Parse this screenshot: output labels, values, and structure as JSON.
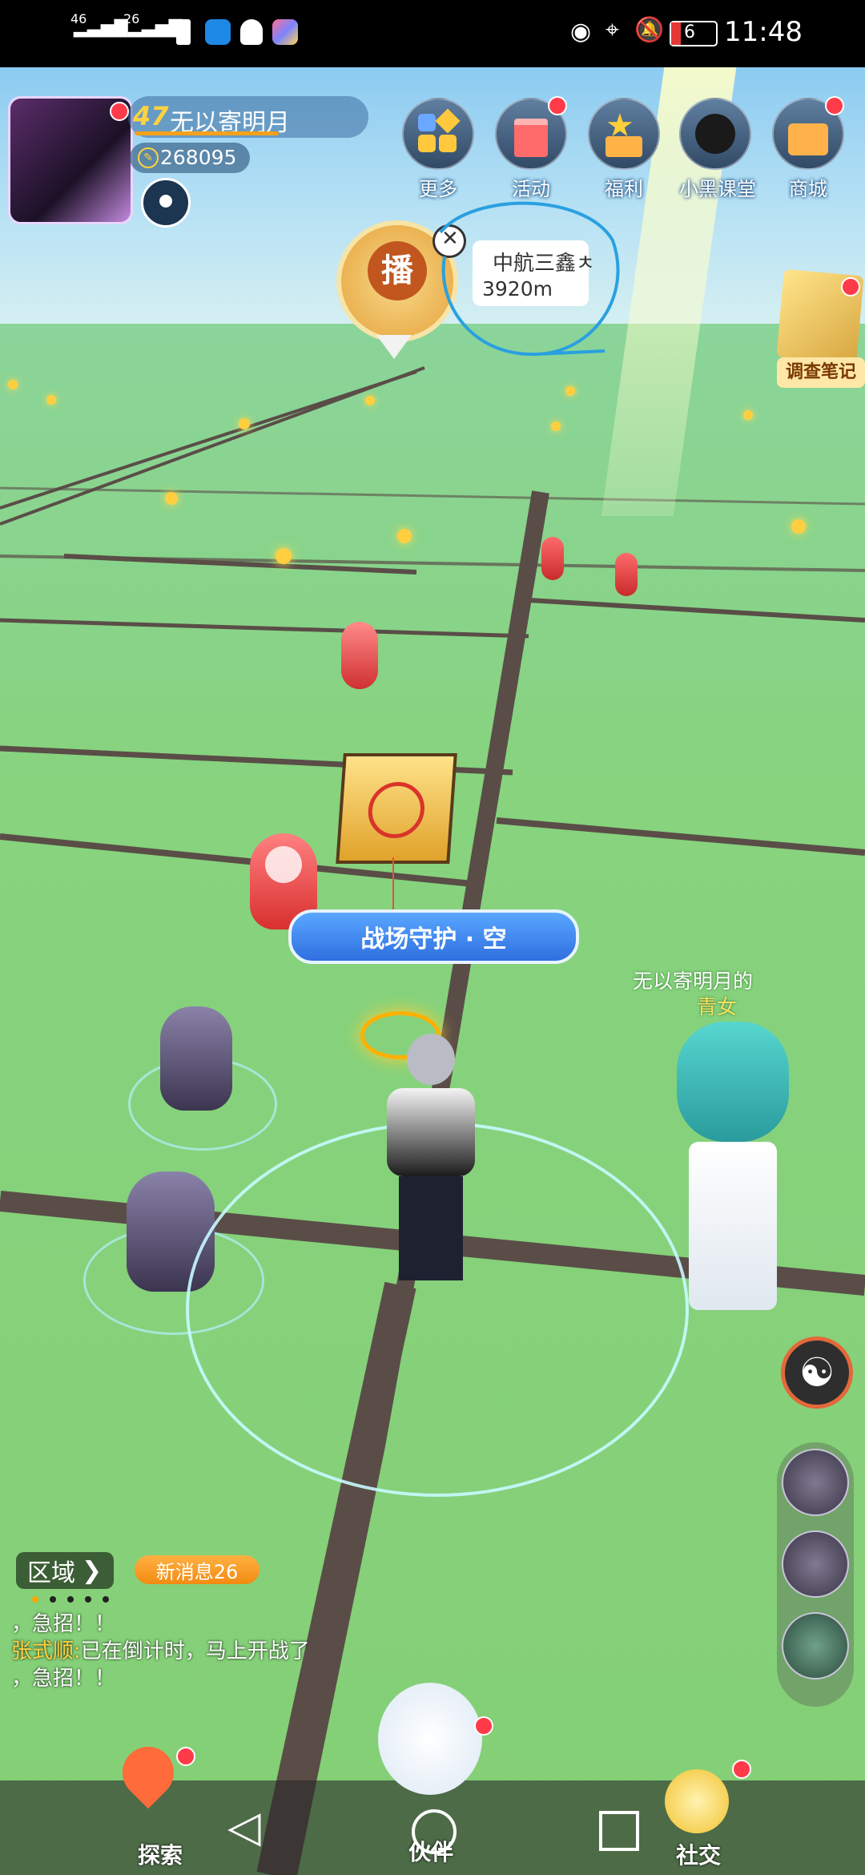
{
  "status_bar": {
    "signal1": "46",
    "signal2": "26",
    "battery": "6",
    "time": "11:48"
  },
  "profile": {
    "level": "47",
    "name": "无以寄明月",
    "coins": "268095"
  },
  "top_menu": [
    {
      "label": "更多"
    },
    {
      "label": "活动"
    },
    {
      "label": "福利"
    },
    {
      "label": "小黑课堂"
    },
    {
      "label": "商城"
    }
  ],
  "broadcast": {
    "icon_text": "播",
    "place": "中航三鑫ㅊ",
    "distance": "3920m"
  },
  "side_note": {
    "label": "调查笔记"
  },
  "map": {
    "banner": "战场守护 · 空",
    "owner_label": "无以寄明月的",
    "pet_label": "青女"
  },
  "chat": {
    "region_label": "区域",
    "new_messages": "新消息26",
    "line1": "，急招！！",
    "line2_name": "张式顺:",
    "line2_text": "已在倒计时，马上开战了",
    "line3": "，急招！！"
  },
  "bottom_nav": {
    "explore": "探索",
    "partner": "伙伴",
    "social": "社交"
  },
  "colors": {
    "badge_red": "#ff3b4a",
    "accent_gold": "#ffd23f",
    "annotation_blue": "#2aa0e0"
  }
}
